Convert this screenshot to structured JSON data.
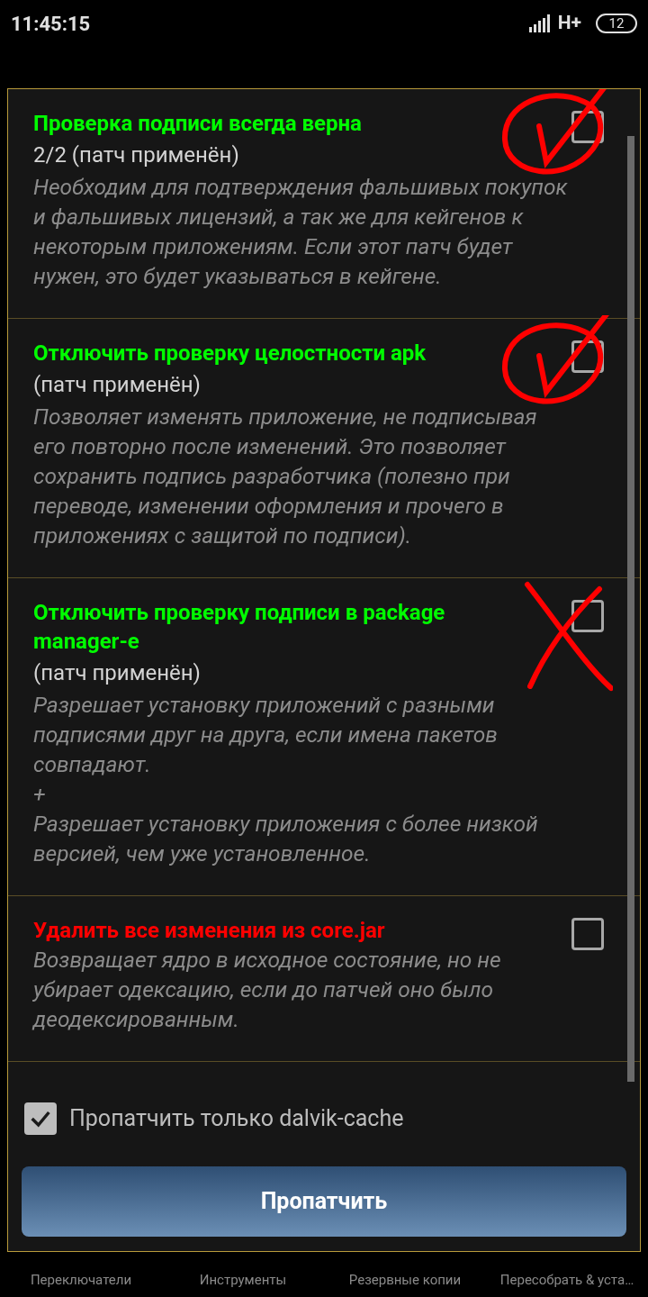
{
  "status_bar": {
    "time": "11:45:15",
    "network": "H+",
    "battery": "12"
  },
  "patches": [
    {
      "title": "Проверка подписи всегда верна",
      "color": "#00ff00",
      "status": "2/2 (патч применён)",
      "description": "Необходим для подтверждения фальшивых покупок и фальшивых лицензий, а так же для кейгенов к некоторым приложениям. Если этот патч будет нужен, это будет указываться в кейгене.",
      "checked": false,
      "kind": "ticked"
    },
    {
      "title": "Отключить проверку целостности apk",
      "color": "#00ff00",
      "status": "(патч применён)",
      "description": "Позволяет изменять приложение, не подписывая его повторно после изменений. Это позволяет сохранить подпись разработчика (полезно при переводе, изменении оформления и прочего в приложениях с защитой по подписи).",
      "checked": false,
      "kind": "ticked"
    },
    {
      "title": "Отключить проверку подписи в package manager-e",
      "color": "#00ff00",
      "status": "(патч применён)",
      "description": "Разрешает установку приложений с разными подписями друг на друга, если имена пакетов совпадают.\n+\nРазрешает установку приложения с более низкой версией, чем уже установленное.",
      "checked": false,
      "kind": "crossed"
    },
    {
      "title": "Удалить все изменения из core.jar",
      "color": "#ff0000",
      "description": "Возвращает ядро в исходное состояние, но не убирает одексацию, если до патчей оно было деодексированным.",
      "checked": false,
      "kind": "plain"
    }
  ],
  "dalvik_option": {
    "label": "Пропатчить только dalvik-cache",
    "checked": true
  },
  "patch_button": "Пропатчить",
  "bottom_nav": [
    "Переключатели",
    "Инструменты",
    "Резервные копии",
    "Пересобрать & уста…"
  ]
}
